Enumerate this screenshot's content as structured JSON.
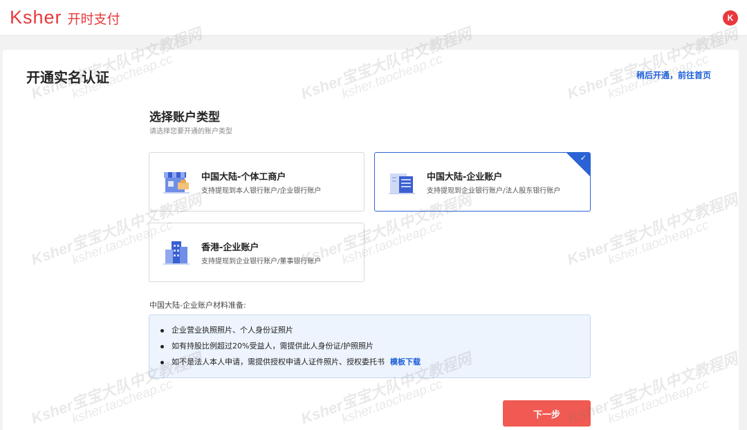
{
  "header": {
    "logo_en": "Ksher",
    "logo_cn": "开时支付",
    "avatar_letter": "K"
  },
  "page": {
    "title": "开通实名认证",
    "skip_link": "稍后开通，前往首页"
  },
  "account_type": {
    "title": "选择账户类型",
    "subtitle": "请选择您要开通的账户类型",
    "options": [
      {
        "title": "中国大陆-个体工商户",
        "desc": "支持提现到本人银行账户/企业银行账户",
        "icon": "shop-icon",
        "selected": false
      },
      {
        "title": "中国大陆-企业账户",
        "desc": "支持提现到企业银行账户/法人股东银行账户",
        "icon": "building-icon",
        "selected": true
      },
      {
        "title": "香港-企业账户",
        "desc": "支持提现到企业银行账户/董事银行账户",
        "icon": "skyscraper-icon",
        "selected": false
      }
    ],
    "check_mark": "✓"
  },
  "materials": {
    "title": "中国大陆-企业账户材料准备:",
    "items": [
      "企业营业执照照片、个人身份证照片",
      "如有持股比例超过20%受益人，需提供此人身份证/护照照片",
      "如不是法人本人申请，需提供授权申请人证件照片、授权委托书"
    ],
    "template_link": "模板下载"
  },
  "next_button": "下一步",
  "watermark": {
    "line1": "Ksher宝宝大队中文教程网",
    "line2": "ksher.taocheap.cc"
  },
  "colors": {
    "brand_red": "#e8383d",
    "accent_blue": "#2b63d4",
    "button_red": "#f05a52"
  }
}
